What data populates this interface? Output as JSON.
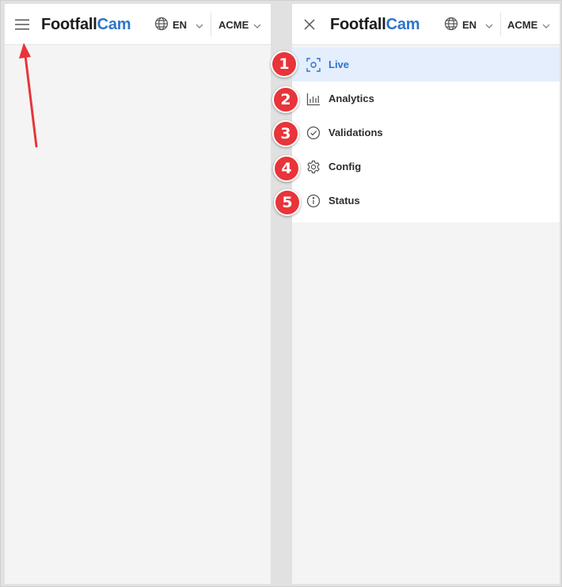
{
  "brand": {
    "part1": "Footfall",
    "part2": "Cam"
  },
  "header": {
    "language": "EN",
    "organization": "ACME"
  },
  "menu": {
    "items": [
      {
        "label": "Live",
        "icon": "live-view-icon",
        "active": true
      },
      {
        "label": "Analytics",
        "icon": "bar-chart-icon",
        "active": false
      },
      {
        "label": "Validations",
        "icon": "check-circle-icon",
        "active": false
      },
      {
        "label": "Config",
        "icon": "gear-icon",
        "active": false
      },
      {
        "label": "Status",
        "icon": "info-circle-icon",
        "active": false
      }
    ]
  },
  "annotations": {
    "badges": [
      "1",
      "2",
      "3",
      "4",
      "5"
    ]
  },
  "colors": {
    "brand_blue": "#2d73cc",
    "active_bg": "#e4eefc",
    "badge_red": "#e8343b",
    "arrow_red": "#e8343b"
  }
}
